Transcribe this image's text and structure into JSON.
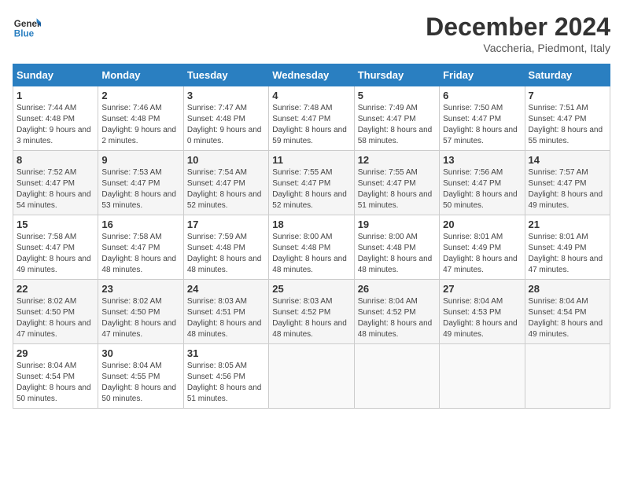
{
  "header": {
    "logo_line1": "General",
    "logo_line2": "Blue",
    "month_title": "December 2024",
    "location": "Vaccheria, Piedmont, Italy"
  },
  "days_of_week": [
    "Sunday",
    "Monday",
    "Tuesday",
    "Wednesday",
    "Thursday",
    "Friday",
    "Saturday"
  ],
  "weeks": [
    [
      {
        "day": "1",
        "sunrise": "7:44 AM",
        "sunset": "4:48 PM",
        "daylight": "9 hours and 3 minutes."
      },
      {
        "day": "2",
        "sunrise": "7:46 AM",
        "sunset": "4:48 PM",
        "daylight": "9 hours and 2 minutes."
      },
      {
        "day": "3",
        "sunrise": "7:47 AM",
        "sunset": "4:48 PM",
        "daylight": "9 hours and 0 minutes."
      },
      {
        "day": "4",
        "sunrise": "7:48 AM",
        "sunset": "4:47 PM",
        "daylight": "8 hours and 59 minutes."
      },
      {
        "day": "5",
        "sunrise": "7:49 AM",
        "sunset": "4:47 PM",
        "daylight": "8 hours and 58 minutes."
      },
      {
        "day": "6",
        "sunrise": "7:50 AM",
        "sunset": "4:47 PM",
        "daylight": "8 hours and 57 minutes."
      },
      {
        "day": "7",
        "sunrise": "7:51 AM",
        "sunset": "4:47 PM",
        "daylight": "8 hours and 55 minutes."
      }
    ],
    [
      {
        "day": "8",
        "sunrise": "7:52 AM",
        "sunset": "4:47 PM",
        "daylight": "8 hours and 54 minutes."
      },
      {
        "day": "9",
        "sunrise": "7:53 AM",
        "sunset": "4:47 PM",
        "daylight": "8 hours and 53 minutes."
      },
      {
        "day": "10",
        "sunrise": "7:54 AM",
        "sunset": "4:47 PM",
        "daylight": "8 hours and 52 minutes."
      },
      {
        "day": "11",
        "sunrise": "7:55 AM",
        "sunset": "4:47 PM",
        "daylight": "8 hours and 52 minutes."
      },
      {
        "day": "12",
        "sunrise": "7:55 AM",
        "sunset": "4:47 PM",
        "daylight": "8 hours and 51 minutes."
      },
      {
        "day": "13",
        "sunrise": "7:56 AM",
        "sunset": "4:47 PM",
        "daylight": "8 hours and 50 minutes."
      },
      {
        "day": "14",
        "sunrise": "7:57 AM",
        "sunset": "4:47 PM",
        "daylight": "8 hours and 49 minutes."
      }
    ],
    [
      {
        "day": "15",
        "sunrise": "7:58 AM",
        "sunset": "4:47 PM",
        "daylight": "8 hours and 49 minutes."
      },
      {
        "day": "16",
        "sunrise": "7:58 AM",
        "sunset": "4:47 PM",
        "daylight": "8 hours and 48 minutes."
      },
      {
        "day": "17",
        "sunrise": "7:59 AM",
        "sunset": "4:48 PM",
        "daylight": "8 hours and 48 minutes."
      },
      {
        "day": "18",
        "sunrise": "8:00 AM",
        "sunset": "4:48 PM",
        "daylight": "8 hours and 48 minutes."
      },
      {
        "day": "19",
        "sunrise": "8:00 AM",
        "sunset": "4:48 PM",
        "daylight": "8 hours and 48 minutes."
      },
      {
        "day": "20",
        "sunrise": "8:01 AM",
        "sunset": "4:49 PM",
        "daylight": "8 hours and 47 minutes."
      },
      {
        "day": "21",
        "sunrise": "8:01 AM",
        "sunset": "4:49 PM",
        "daylight": "8 hours and 47 minutes."
      }
    ],
    [
      {
        "day": "22",
        "sunrise": "8:02 AM",
        "sunset": "4:50 PM",
        "daylight": "8 hours and 47 minutes."
      },
      {
        "day": "23",
        "sunrise": "8:02 AM",
        "sunset": "4:50 PM",
        "daylight": "8 hours and 47 minutes."
      },
      {
        "day": "24",
        "sunrise": "8:03 AM",
        "sunset": "4:51 PM",
        "daylight": "8 hours and 48 minutes."
      },
      {
        "day": "25",
        "sunrise": "8:03 AM",
        "sunset": "4:52 PM",
        "daylight": "8 hours and 48 minutes."
      },
      {
        "day": "26",
        "sunrise": "8:04 AM",
        "sunset": "4:52 PM",
        "daylight": "8 hours and 48 minutes."
      },
      {
        "day": "27",
        "sunrise": "8:04 AM",
        "sunset": "4:53 PM",
        "daylight": "8 hours and 49 minutes."
      },
      {
        "day": "28",
        "sunrise": "8:04 AM",
        "sunset": "4:54 PM",
        "daylight": "8 hours and 49 minutes."
      }
    ],
    [
      {
        "day": "29",
        "sunrise": "8:04 AM",
        "sunset": "4:54 PM",
        "daylight": "8 hours and 50 minutes."
      },
      {
        "day": "30",
        "sunrise": "8:04 AM",
        "sunset": "4:55 PM",
        "daylight": "8 hours and 50 minutes."
      },
      {
        "day": "31",
        "sunrise": "8:05 AM",
        "sunset": "4:56 PM",
        "daylight": "8 hours and 51 minutes."
      },
      null,
      null,
      null,
      null
    ]
  ],
  "labels": {
    "sunrise_prefix": "Sunrise: ",
    "sunset_prefix": "Sunset: ",
    "daylight_prefix": "Daylight: "
  }
}
